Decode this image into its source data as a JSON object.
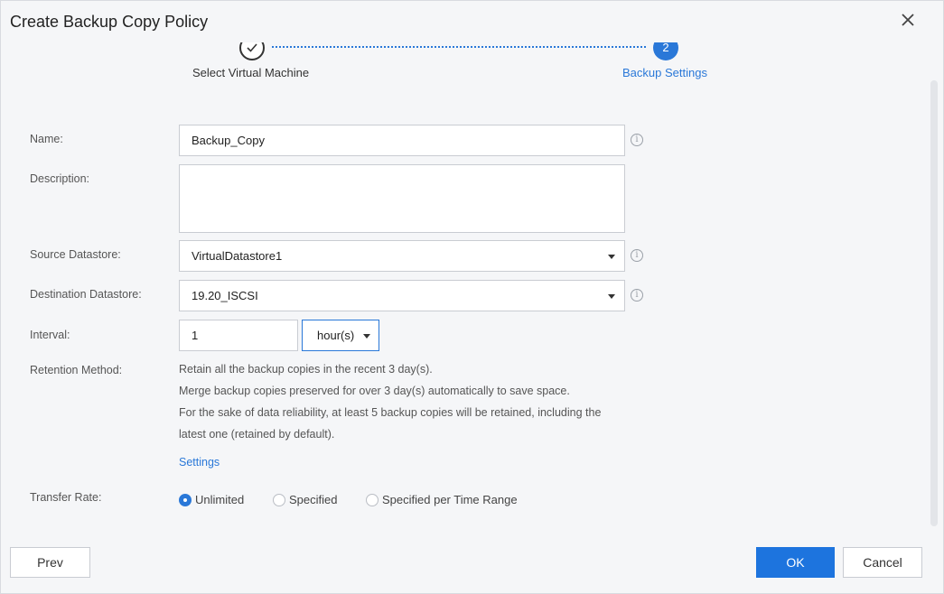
{
  "dialog": {
    "title": "Create Backup Copy Policy"
  },
  "steps": [
    {
      "label": "Select Virtual Machine",
      "status": "completed"
    },
    {
      "label": "Backup Settings",
      "number": "2",
      "status": "current"
    }
  ],
  "form": {
    "name": {
      "label": "Name:",
      "value": "Backup_Copy"
    },
    "description": {
      "label": "Description:",
      "value": ""
    },
    "source_datastore": {
      "label": "Source Datastore:",
      "value": "VirtualDatastore1"
    },
    "destination_datastore": {
      "label": "Destination Datastore:",
      "value": "19.20_ISCSI"
    },
    "interval": {
      "label": "Interval:",
      "value": "1",
      "unit": "hour(s)"
    },
    "retention": {
      "label": "Retention Method:",
      "lines": [
        "Retain all the backup copies in the recent 3 day(s).",
        "Merge backup copies preserved for over 3 day(s) automatically to save space.",
        "For the sake of data reliability, at least 5 backup copies will be retained, including the",
        "latest one (retained by default)."
      ],
      "settings_link": "Settings"
    },
    "transfer_rate": {
      "label": "Transfer Rate:",
      "options": [
        "Unlimited",
        "Specified",
        "Specified per Time Range"
      ],
      "selected": "Unlimited"
    }
  },
  "footer": {
    "prev_label": "Prev",
    "ok_label": "OK",
    "cancel_label": "Cancel"
  },
  "colors": {
    "accent": "#2a78d8",
    "primary_button": "#1d74de"
  }
}
